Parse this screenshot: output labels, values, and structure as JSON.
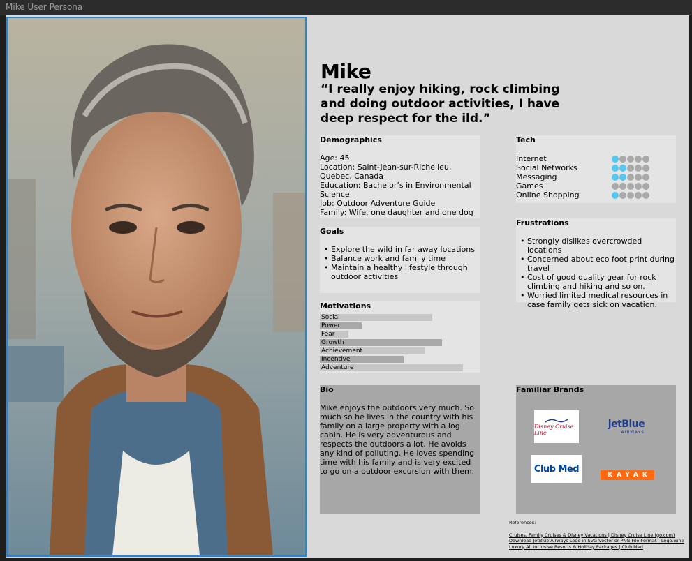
{
  "window": {
    "title": "Mike User Persona"
  },
  "persona": {
    "name": "Mike",
    "quote": "“I really enjoy hiking, rock climbing and doing outdoor activities,  I have deep respect for the ild.”"
  },
  "demographics": {
    "title": "Demographics",
    "lines": [
      "Age: 45",
      "Location: Saint-Jean-sur-Richelieu, Quebec, Canada",
      "Education: Bachelor’s in Environmental Science",
      "Job: Outdoor Adventure Guide",
      "Family: Wife, one daughter and one dog"
    ]
  },
  "goals": {
    "title": "Goals",
    "items": [
      "Explore the wild in far away locations",
      "Balance work and family time",
      "Maintain a healthy lifestyle through outdoor activities"
    ]
  },
  "motivations": {
    "title": "Motivations",
    "items": [
      {
        "label": "Social",
        "value": 0.7
      },
      {
        "label": "Power",
        "value": 0.26
      },
      {
        "label": "Fear",
        "value": 0.18
      },
      {
        "label": "Growth",
        "value": 0.76
      },
      {
        "label": "Achievement",
        "value": 0.65
      },
      {
        "label": "Incentive",
        "value": 0.52
      },
      {
        "label": "Adventure",
        "value": 0.89
      }
    ]
  },
  "bio": {
    "title": "Bio",
    "text": "Mike enjoys the outdoors very much. So much so he lives in the country with his family on a large property with a log cabin. He is very adventurous and respects the outdoors a lot. He avoids any kind of polluting. He loves spending time with his family and is very excited to go on a outdoor excursion with them."
  },
  "tech": {
    "title": "Tech",
    "items": [
      {
        "label": "Internet",
        "level": 1
      },
      {
        "label": "Social Networks",
        "level": 2
      },
      {
        "label": "Messaging",
        "level": 2
      },
      {
        "label": "Games",
        "level": 0
      },
      {
        "label": "Online Shopping",
        "level": 1
      }
    ],
    "max_level": 5,
    "colors": {
      "on": "#56c8f0",
      "off": "#a9a9a9"
    }
  },
  "frustrations": {
    "title": "Frustrations",
    "items": [
      "Strongly dislikes overcrowded locations",
      "Concerned about eco foot print during travel",
      "Cost of good quality gear for rock climbing and hiking and so on.",
      "Worried limited medical resources in case family gets sick on vacation."
    ]
  },
  "brands": {
    "title": "Familiar Brands",
    "logos": [
      {
        "name": "disney-cruise-line-logo",
        "text": "Disney Cruise Line"
      },
      {
        "name": "jetblue-logo",
        "text": "jetBlue",
        "sub": "AIRWAYS"
      },
      {
        "name": "club-med-logo",
        "text": "Club Med"
      },
      {
        "name": "kayak-logo",
        "text": "KAYAK"
      }
    ]
  },
  "references": {
    "title": "References:",
    "links": [
      "Cruises, Family Cruises & Disney Vacations | Disney Cruise Line (go.com)",
      "Download JetBlue Airways Logo in SVG Vector or PNG File Format - Logo.wine",
      "Luxury All Inclusive Resorts & Holiday Packages | Club Med"
    ]
  }
}
